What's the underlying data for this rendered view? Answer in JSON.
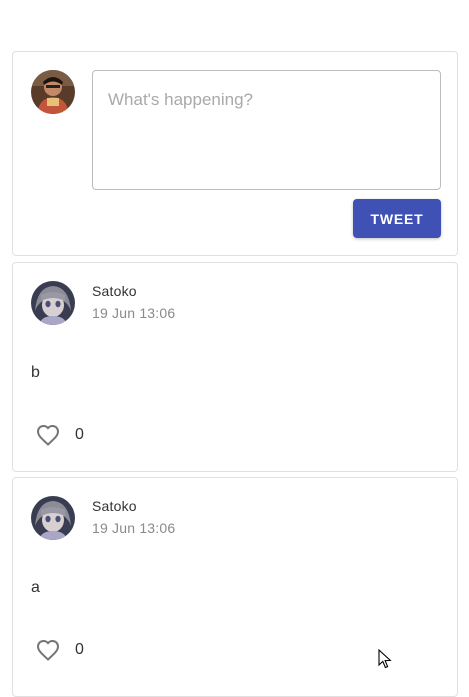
{
  "compose": {
    "placeholder": "What's happening?",
    "button_label": "TWEET",
    "avatar_icon": "user-photo-avatar"
  },
  "tweets": [
    {
      "author": "Satoko",
      "timestamp": "19 Jun 13:06",
      "body": "b",
      "likes": "0",
      "avatar_icon": "anime-character-avatar",
      "like_icon": "heart-outline-icon"
    },
    {
      "author": "Satoko",
      "timestamp": "19 Jun 13:06",
      "body": "a",
      "likes": "0",
      "avatar_icon": "anime-character-avatar",
      "like_icon": "heart-outline-icon"
    }
  ],
  "colors": {
    "accent": "#3f51b5",
    "border": "#e0e0e0",
    "muted_text": "#8a8a8a"
  }
}
